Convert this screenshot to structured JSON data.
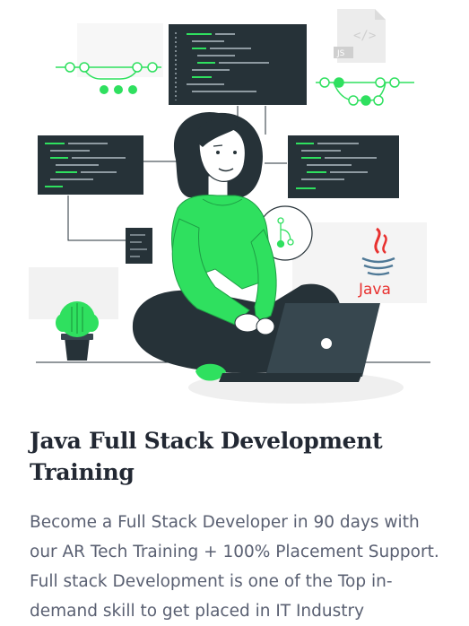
{
  "card": {
    "title": "Java Full Stack Development Training",
    "description": "Become a Full Stack Developer in 90 days with our AR Tech Training + 100% Placement Support. Full stack Development is one of the Top in-demand skill to get placed in IT Industry"
  },
  "illustration": {
    "java_logo_text": "Java",
    "file_badge": "JS",
    "colors": {
      "accent": "#2fe05f",
      "dark": "#263238",
      "java_red": "#e8312f"
    }
  }
}
